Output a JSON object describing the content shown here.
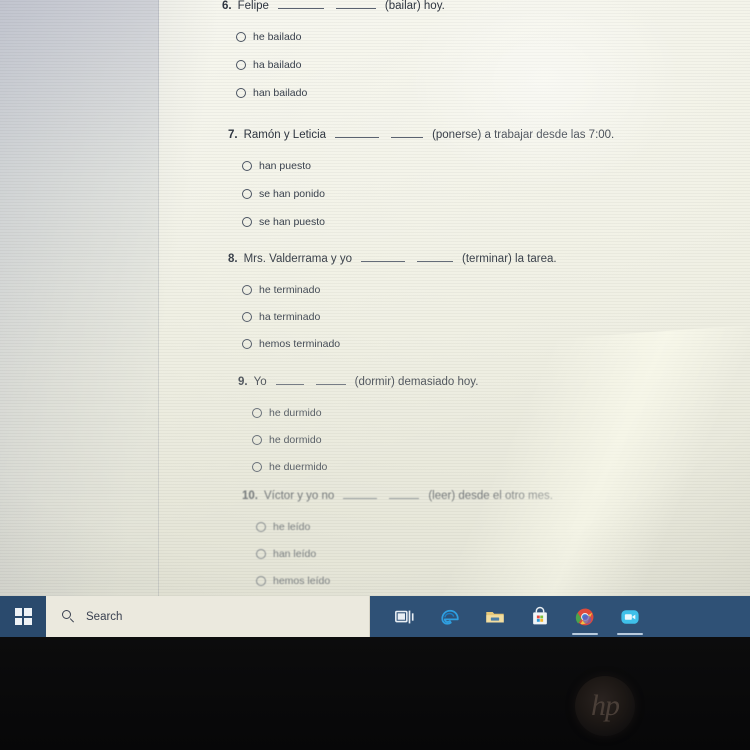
{
  "document": {
    "type": "spanish-grammar-quiz",
    "questions": [
      {
        "number": "6.",
        "prompt_before": "Felipe",
        "prompt_after": "(bailar) hoy.",
        "options": [
          "he bailado",
          "ha bailado",
          "han bailado"
        ]
      },
      {
        "number": "7.",
        "prompt_before": "Ramón y Leticia",
        "prompt_after": "(ponerse) a trabajar desde las 7:00.",
        "options": [
          "han puesto",
          "se han ponido",
          "se han puesto"
        ]
      },
      {
        "number": "8.",
        "prompt_before": "Mrs. Valderrama y yo",
        "prompt_after": "(terminar) la tarea.",
        "options": [
          "he terminado",
          "ha terminado",
          "hemos terminado"
        ]
      },
      {
        "number": "9.",
        "prompt_before": "Yo",
        "prompt_after": "(dormir) demasiado hoy.",
        "options": [
          "he durmido",
          "he dormido",
          "he duermido"
        ]
      },
      {
        "number": "10.",
        "prompt_before": "Víctor y yo no",
        "prompt_after": "(leer) desde el otro mes.",
        "options": [
          "he leído",
          "han leído",
          "hemos leído"
        ]
      }
    ]
  },
  "taskbar": {
    "start_label": "Start",
    "search": {
      "placeholder": "Search",
      "value": "Search",
      "icon": "search-icon"
    },
    "items": [
      {
        "name": "task-view",
        "label": "Task View"
      },
      {
        "name": "edge",
        "label": "Microsoft Edge"
      },
      {
        "name": "file-explorer",
        "label": "File Explorer"
      },
      {
        "name": "microsoft-store",
        "label": "Microsoft Store"
      },
      {
        "name": "google-chrome",
        "label": "Google Chrome",
        "running": true
      },
      {
        "name": "video-app",
        "label": "Video App",
        "running": true
      }
    ],
    "colors": {
      "background": "#2f5176",
      "search_background": "#ebe9de",
      "indicator": "#b9cbdd"
    }
  },
  "device": {
    "brand_logo": "hp",
    "bezel_color": "#0a0a0b"
  }
}
